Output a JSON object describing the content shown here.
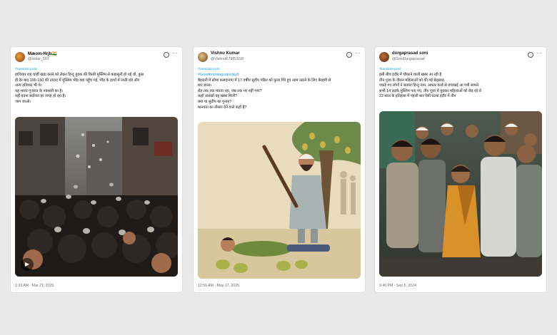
{
  "cards": [
    {
      "username": "Mæom-Hrjb🇮🇳",
      "handle": "@sekar_591",
      "translate": "Translate post",
      "text": [
        "हाथियार राह चाहीं खड़ा करने को लेकर हिन्दू युवक की किसी मुस्लिम से कहासुनी हो गई थी, कुछ",
        "ही देर बाद 100-150 की तादाद में मुस्लिम भीड़ वहां पहुँच गई, भीड़ के हाथों में लाठी-डंडे और",
        "अन्य हथियार भी थे।",
        "यह भारत गुजरात के नवसारी का है।",
        "यहीं इतना बर्दाशंत हर जगह हो रहा है।",
        "जाग जाओ।"
      ],
      "timestamp": "1:33 AM · Mar 21, 2025",
      "image_alt": "crowd-photo"
    },
    {
      "username": "Vishnu Kumar",
      "handle": "@VishnuK79851G8",
      "translate": "Translate post",
      "hashtag": "#Goodmorningsaturday",
      "text": [
        "!",
        "बैहरानी में सोमा फ़सदानपा में 17 वर्षीय सुदीप पंडित को फुला गिरे हुए आम उठाने के लिए बेरहमी से",
        "मार डाला।",
        "रोड तक तक मारता रहा, जब तक मर नहीं गया?",
        "कहाँ आरखों वह खबर मिली?",
        "क्या था सुदीप का गुनाह?",
        "मानवता का तीसरा देने वाले कहाँ हैं?"
      ],
      "timestamp": "12:56 AM · May 17, 2025",
      "image_alt": "illustration"
    },
    {
      "username": "durgaprasad soni",
      "handle": "@SoniDurgaprasad",
      "translate": "Translate post",
      "text": [
        "इसी बीच इंदौर में चौकाने वाली खबर आ रही है",
        "तीन पूजा के दौरान महिलाओं को की गई छेड़छाड़",
        "पकड़े गए लोगों ने बताया हिन्दु नाम, आधार कार्ड से बचाकई आ गयी सामने",
        "सभी 14 लड़के मुस्लिम पाए गए, तीन पूजा में युवकर महिलाओं को छेड़ रहे थे",
        "22 साल के इतिहास में पहली बार ऐसी घटना इंदौर में तीन"
      ],
      "timestamp": "9:46 PM · Sep 5, 2024",
      "image_alt": "crowd-photo"
    }
  ]
}
